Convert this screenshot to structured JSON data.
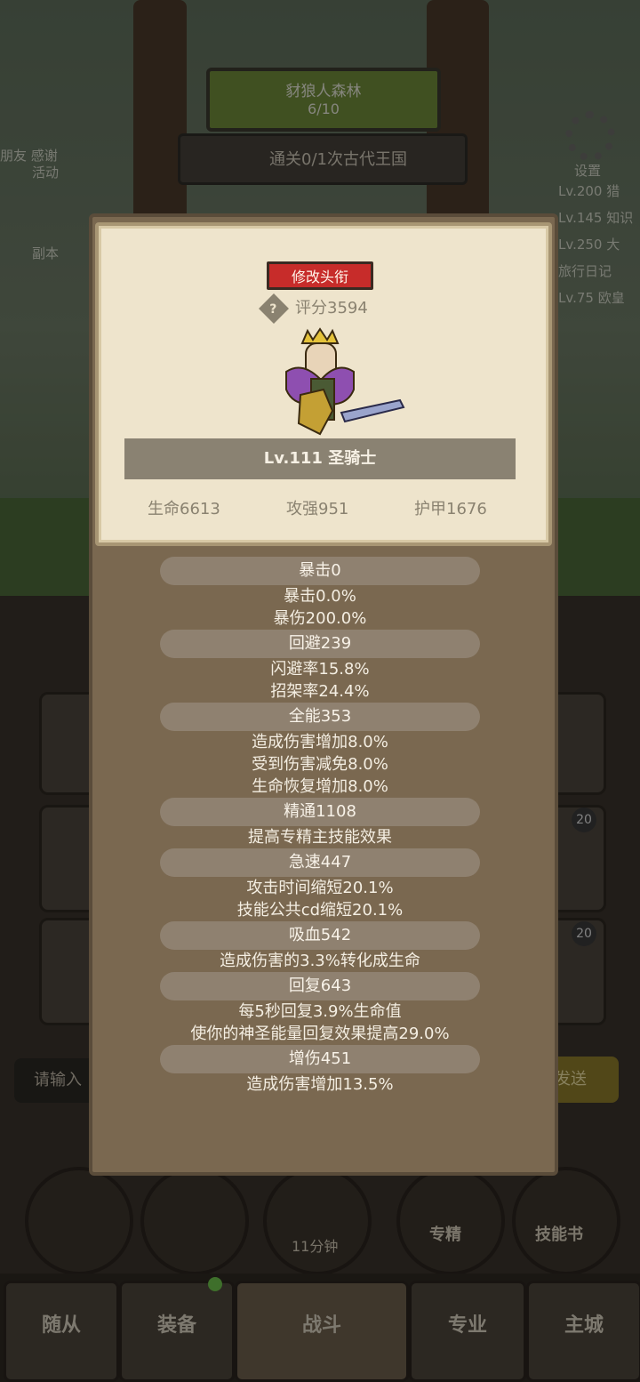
{
  "background": {
    "map_title": "豺狼人森林",
    "map_progress": "6/10",
    "quest_text": "通关0/1次古代王国",
    "left_label_1": "朋友 感谢",
    "left_label_2": "活动",
    "left_label_3": "副本",
    "settings_label": "设置",
    "right_lines": [
      "Lv.200 猎",
      "Lv.145 知识",
      "Lv.250 大",
      "旅行日记",
      "Lv.75 欧皇"
    ],
    "chat_placeholder": "请输入",
    "send_label": "发送",
    "badge_20a": "20",
    "badge_20b": "20",
    "timer_label": "11分钟",
    "specialty_label": "专精",
    "skillbook_label": "技能书",
    "nav": [
      "随从",
      "装备",
      "战斗",
      "专业",
      "主城"
    ]
  },
  "dialog": {
    "rename_button": "修改头衔",
    "score": "评分3594",
    "level_class": "Lv.111 圣骑士",
    "hp": "生命6613",
    "atk": "攻强951",
    "armor": "护甲1676",
    "sections": [
      {
        "header": "暴击0",
        "lines": [
          "暴击0.0%",
          "暴伤200.0%"
        ]
      },
      {
        "header": "回避239",
        "lines": [
          "闪避率15.8%",
          "招架率24.4%"
        ]
      },
      {
        "header": "全能353",
        "lines": [
          "造成伤害增加8.0%",
          "受到伤害减免8.0%",
          "生命恢复增加8.0%"
        ]
      },
      {
        "header": "精通1108",
        "lines": [
          "提高专精主技能效果"
        ]
      },
      {
        "header": "急速447",
        "lines": [
          "攻击时间缩短20.1%",
          "技能公共cd缩短20.1%"
        ]
      },
      {
        "header": "吸血542",
        "lines": [
          "造成伤害的3.3%转化成生命"
        ]
      },
      {
        "header": "回复643",
        "lines": [
          "每5秒回复3.9%生命值",
          "使你的神圣能量回复效果提高29.0%"
        ]
      },
      {
        "header": "增伤451",
        "lines": [
          "造成伤害增加13.5%"
        ]
      }
    ]
  }
}
